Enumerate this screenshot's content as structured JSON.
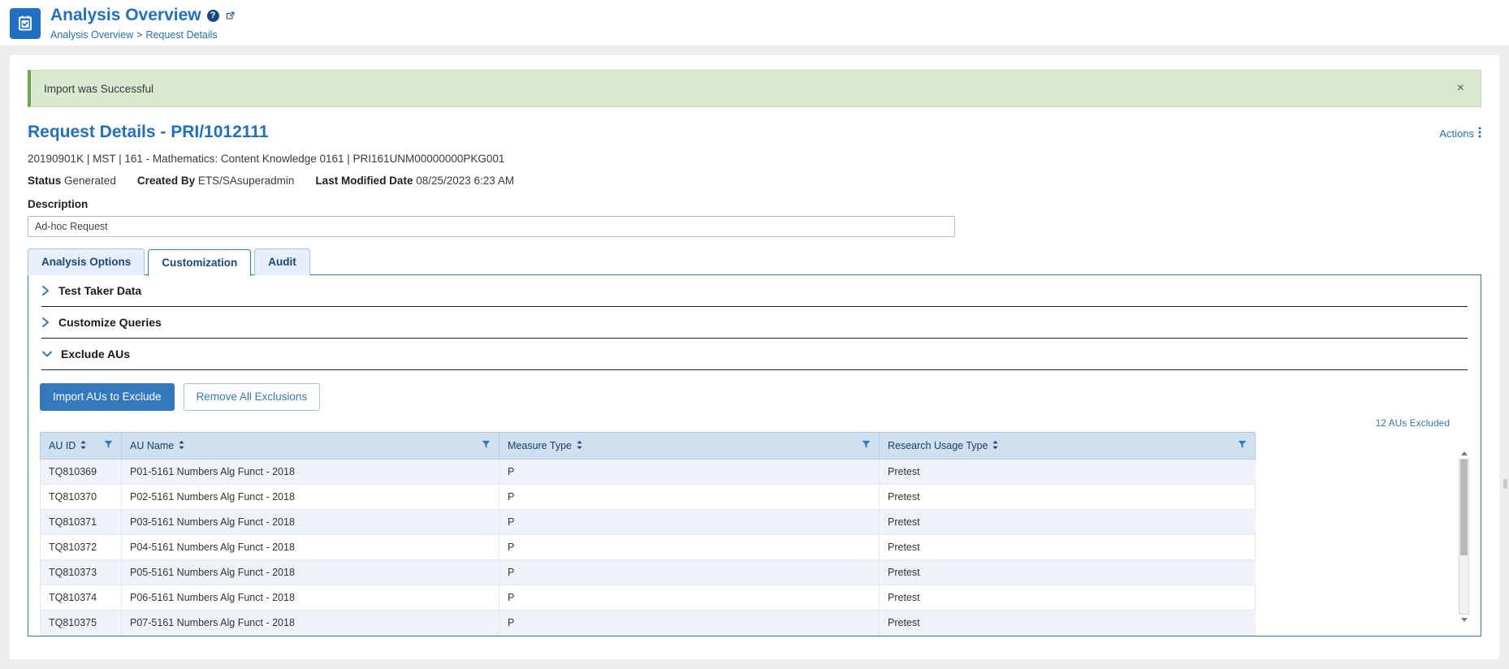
{
  "header": {
    "app_icon": "clipboard-check-icon",
    "title": "Analysis Overview",
    "help_icon": "?",
    "external_link_icon": "external-link-icon",
    "breadcrumb": {
      "root": "Analysis Overview",
      "separator": ">",
      "current": "Request Details"
    }
  },
  "alert": {
    "message": "Import was Successful",
    "close_label": "×"
  },
  "request": {
    "title": "Request Details - PRI/1012111",
    "actions_label": "Actions",
    "actions_icon": "kebab-menu-icon",
    "meta": "20190901K | MST | 161 - Mathematics: Content Knowledge 0161 | PRI161UNM00000000PKG001",
    "status_label": "Status",
    "status_value": "Generated",
    "created_by_label": "Created By",
    "created_by_value": "ETS/SAsuperadmin",
    "last_modified_label": "Last Modified Date",
    "last_modified_value": "08/25/2023 6:23 AM",
    "description_label": "Description",
    "description_value": "Ad-hoc Request",
    "description_placeholder": "Description"
  },
  "tabs": [
    {
      "label": "Analysis Options",
      "active": false
    },
    {
      "label": "Customization",
      "active": true
    },
    {
      "label": "Audit",
      "active": false
    }
  ],
  "accordions": [
    {
      "label": "Test Taker Data",
      "expanded": false,
      "icon": "chevron-right-icon"
    },
    {
      "label": "Customize Queries",
      "expanded": false,
      "icon": "chevron-right-icon"
    },
    {
      "label": "Exclude AUs",
      "expanded": true,
      "icon": "chevron-down-icon"
    }
  ],
  "exclude_aus": {
    "import_button": "Import AUs to Exclude",
    "remove_button": "Remove All Exclusions",
    "excluded_count_text": "12 AUs Excluded",
    "columns": [
      {
        "label": "AU ID",
        "sortable": true,
        "filterable": true
      },
      {
        "label": "AU Name",
        "sortable": true,
        "filterable": true
      },
      {
        "label": "Measure Type",
        "sortable": true,
        "filterable": true
      },
      {
        "label": "Research Usage Type",
        "sortable": true,
        "filterable": true
      }
    ],
    "rows": [
      {
        "au_id": "TQ810369",
        "au_name": "P01-5161 Numbers Alg Funct - 2018",
        "measure_type": "P",
        "research_usage_type": "Pretest"
      },
      {
        "au_id": "TQ810370",
        "au_name": "P02-5161 Numbers Alg Funct - 2018",
        "measure_type": "P",
        "research_usage_type": "Pretest"
      },
      {
        "au_id": "TQ810371",
        "au_name": "P03-5161 Numbers Alg Funct - 2018",
        "measure_type": "P",
        "research_usage_type": "Pretest"
      },
      {
        "au_id": "TQ810372",
        "au_name": "P04-5161 Numbers Alg Funct - 2018",
        "measure_type": "P",
        "research_usage_type": "Pretest"
      },
      {
        "au_id": "TQ810373",
        "au_name": "P05-5161 Numbers Alg Funct - 2018",
        "measure_type": "P",
        "research_usage_type": "Pretest"
      },
      {
        "au_id": "TQ810374",
        "au_name": "P06-5161 Numbers Alg Funct - 2018",
        "measure_type": "P",
        "research_usage_type": "Pretest"
      },
      {
        "au_id": "TQ810375",
        "au_name": "P07-5161 Numbers Alg Funct - 2018",
        "measure_type": "P",
        "research_usage_type": "Pretest"
      }
    ]
  },
  "colors": {
    "brand_blue": "#1f6fc4",
    "header_blue": "#17497f",
    "alert_green_bg": "#dbe9d0",
    "alert_green_border": "#6aa84f",
    "table_header_bg": "#cfe0f0",
    "row_alt_bg": "#eef3f9",
    "primary_button": "#3479bd"
  }
}
